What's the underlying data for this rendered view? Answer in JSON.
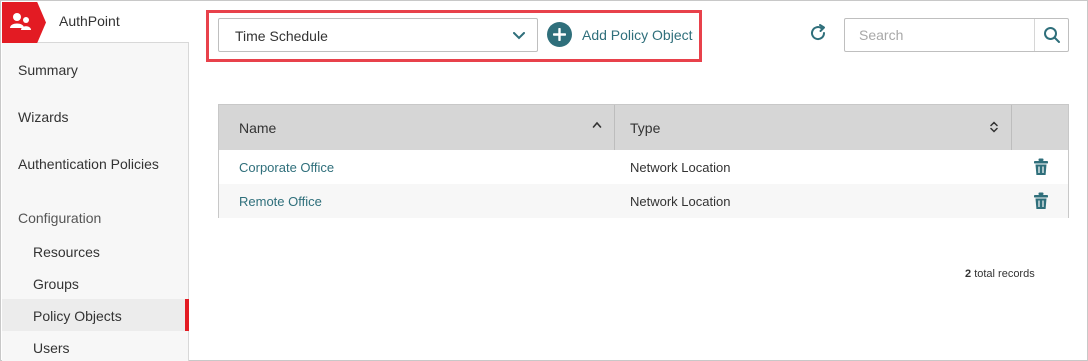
{
  "app": {
    "name": "AuthPoint",
    "brand_color": "#e31b23",
    "accent_color": "#2f6f7b"
  },
  "sidebar": {
    "items": [
      {
        "label": "Summary"
      },
      {
        "label": "Wizards"
      },
      {
        "label": "Authentication Policies"
      }
    ],
    "section_label": "Configuration",
    "sub_items": [
      {
        "label": "Resources"
      },
      {
        "label": "Groups"
      },
      {
        "label": "Policy Objects",
        "active": true
      },
      {
        "label": "Users"
      }
    ]
  },
  "toolbar": {
    "policy_object_type": "Time Schedule",
    "add_label": "Add Policy Object",
    "search_placeholder": "Search"
  },
  "table": {
    "columns": [
      "Name",
      "Type"
    ],
    "rows": [
      {
        "name": "Corporate Office",
        "type": "Network Location"
      },
      {
        "name": "Remote Office",
        "type": "Network Location"
      }
    ]
  },
  "footer": {
    "records_count": "2",
    "records_label": "total records"
  },
  "icons": {
    "brand": "users-icon",
    "dropdown": "chevron-down-icon",
    "add": "plus-icon",
    "refresh": "refresh-icon",
    "search": "search-icon",
    "sort_asc": "sort-ascending-icon",
    "sort": "sort-icon",
    "delete": "trash-icon"
  }
}
